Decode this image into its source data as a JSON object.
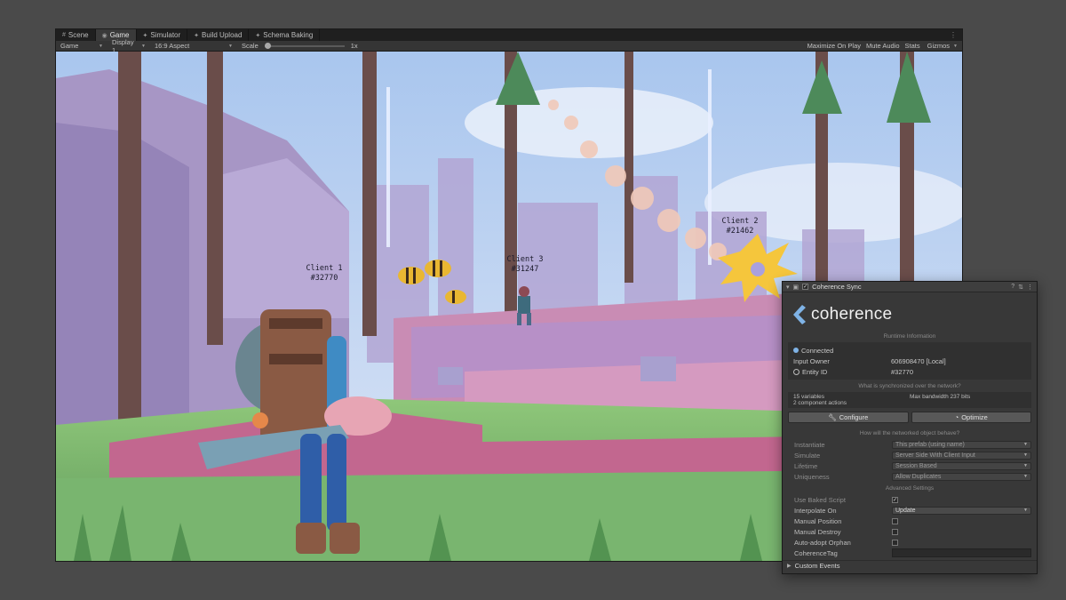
{
  "tabs": [
    {
      "icon": "grid-icon",
      "label": "Scene",
      "active": false
    },
    {
      "icon": "gamepad-icon",
      "label": "Game",
      "active": true
    },
    {
      "icon": "simulator-icon",
      "label": "Simulator",
      "active": false
    },
    {
      "icon": "upload-icon",
      "label": "Build Upload",
      "active": false
    },
    {
      "icon": "baking-icon",
      "label": "Schema Baking",
      "active": false
    }
  ],
  "toolbar": {
    "mode": "Game",
    "display": "Display 1",
    "aspect": "16:9 Aspect",
    "scale_label": "Scale",
    "scale_value": "1x",
    "maximize": "Maximize On Play",
    "mute": "Mute Audio",
    "stats": "Stats",
    "gizmos": "Gizmos"
  },
  "viewport": {
    "clients": [
      {
        "name": "Client 1",
        "id": "#32770"
      },
      {
        "name": "Client 3",
        "id": "#31247"
      },
      {
        "name": "Client 2",
        "id": "#21462"
      }
    ]
  },
  "inspector": {
    "title": "Coherence Sync",
    "logo_text": "coherence",
    "runtime_title": "Runtime Information",
    "connected": "Connected",
    "input_owner_label": "Input Owner",
    "input_owner_value": "606908470 [Local]",
    "entity_id_label": "Entity ID",
    "entity_id_value": "#32770",
    "sync_title": "What is synchronized over the network?",
    "variables": "15 variables",
    "component_actions": "2 component actions",
    "bandwidth": "Max bandwidth 237 bits",
    "configure": "Configure",
    "optimize": "Optimize",
    "behave_title": "How will the networked object behave?",
    "behave_props": [
      {
        "label": "Instantiate",
        "value": "This prefab (using name)"
      },
      {
        "label": "Simulate",
        "value": "Server Side With Client Input"
      },
      {
        "label": "Lifetime",
        "value": "Session Based"
      },
      {
        "label": "Uniqueness",
        "value": "Allow Duplicates"
      }
    ],
    "advanced_title": "Advanced Settings",
    "use_baked_label": "Use Baked Script",
    "interpolate_label": "Interpolate On",
    "interpolate_value": "Update",
    "manual_position_label": "Manual Position",
    "manual_destroy_label": "Manual Destroy",
    "auto_adopt_label": "Auto-adopt Orphan",
    "coherence_tag_label": "CoherenceTag",
    "custom_events": "Custom Events"
  },
  "colors": {
    "accent": "#7fb3e6",
    "panel": "#383838",
    "editor_dark": "#1f1f1f"
  }
}
